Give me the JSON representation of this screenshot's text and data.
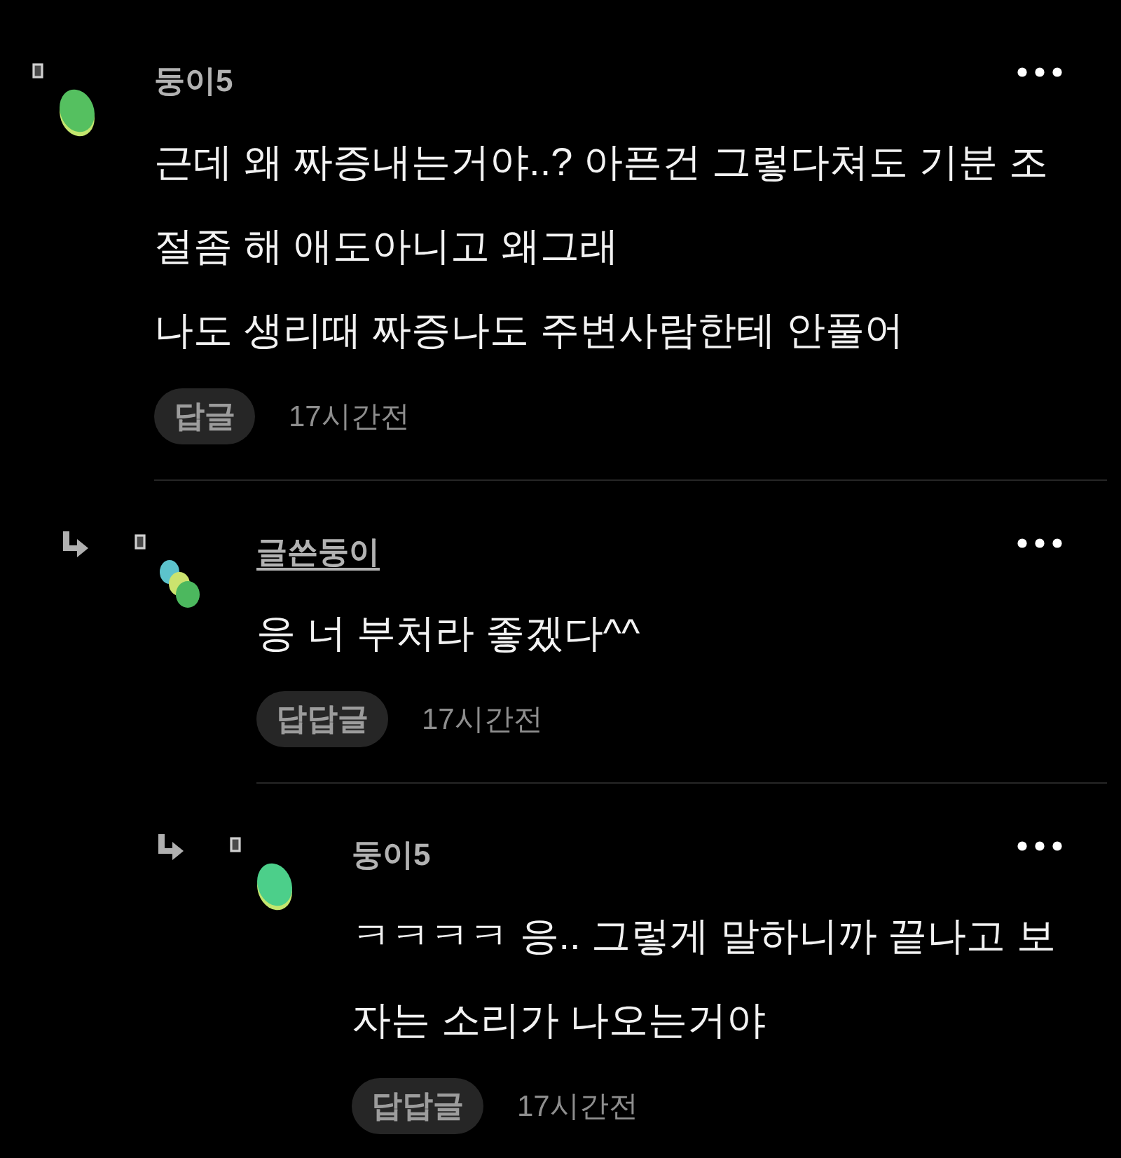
{
  "comments": [
    {
      "author": "둥이5",
      "is_post_author": false,
      "avatar": {
        "kind": "single",
        "color": "#55c060"
      },
      "paragraphs": [
        "근데 왜 짜증내는거야..? 아픈건 그렇다쳐도 기분 조\n절좀 해 애도아니고 왜그래",
        "나도 생리때 짜증나도 주변사람한테 안풀어"
      ],
      "reply_button": "답글",
      "time": "17시간전",
      "children": [
        {
          "author": "글쓴둥이",
          "is_post_author": true,
          "avatar": {
            "kind": "stack"
          },
          "paragraphs": [
            "응 너 부처라 좋겠다^^"
          ],
          "reply_button": "답답글",
          "time": "17시간전",
          "children": [
            {
              "author": "둥이5",
              "is_post_author": false,
              "avatar": {
                "kind": "single",
                "color": "#4ccf8a"
              },
              "paragraphs": [
                "ㅋㅋㅋㅋ 응.. 그렇게 말하니까 끝나고 보\n자는 소리가 나오는거야"
              ],
              "reply_button": "답답글",
              "time": "17시간전"
            }
          ]
        }
      ]
    }
  ]
}
